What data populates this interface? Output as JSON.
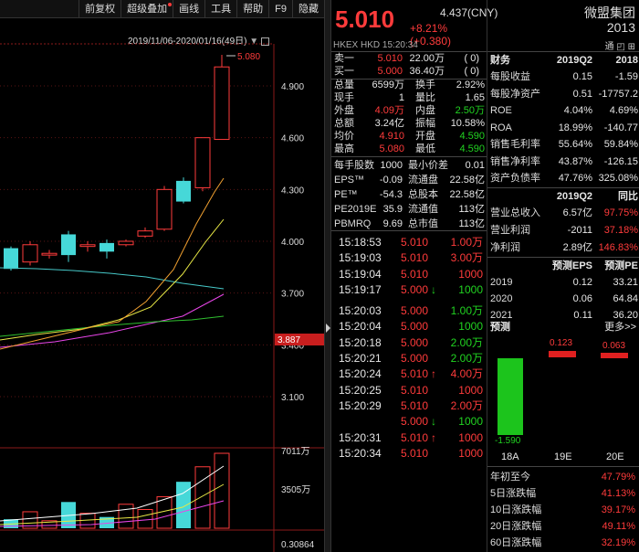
{
  "toolbar": {
    "items": [
      "前复权",
      "超级叠加",
      "画线",
      "工具",
      "帮助",
      "F9",
      "隐藏"
    ]
  },
  "chart": {
    "date_range": "2019/11/06-2020/01/16(49日)",
    "price_labels": [
      "4.900",
      "4.600",
      "4.300",
      "4.000",
      "3.700",
      "3.400",
      "3.100"
    ],
    "current_price_marker": "3.887",
    "peak_label": "5.080",
    "vol_labels": [
      "7011万",
      "3505万"
    ],
    "bottom_label": "0.30864"
  },
  "stock": {
    "price": "5.010",
    "ref": "4.437(CNY)",
    "change": "+8.21% (+0.380)",
    "name": "微盟集团",
    "code": "2013",
    "exchange": "HKEX",
    "currency": "HKD",
    "time": "15:20:34"
  },
  "orderbook": {
    "sell": {
      "label": "卖一",
      "price": "5.010",
      "vol": "22.00万",
      "cnt": "(  0)"
    },
    "buy": {
      "label": "买一",
      "price": "5.000",
      "vol": "36.40万",
      "cnt": "(  0)"
    }
  },
  "stats": [
    {
      "l1": "总量",
      "v1": "6599万",
      "c1": "white",
      "l2": "换手",
      "v2": "2.92%",
      "c2": "white"
    },
    {
      "l1": "现手",
      "v1": "1",
      "c1": "white",
      "l2": "量比",
      "v2": "1.65",
      "c2": "white"
    },
    {
      "l1": "外盘",
      "v1": "4.09万",
      "c1": "red",
      "l2": "内盘",
      "v2": "2.50万",
      "c2": "green"
    },
    {
      "l1": "总额",
      "v1": "3.24亿",
      "c1": "white",
      "l2": "振幅",
      "v2": "10.58%",
      "c2": "white"
    },
    {
      "l1": "均价",
      "v1": "4.910",
      "c1": "red",
      "l2": "开盘",
      "v2": "4.590",
      "c2": "green"
    },
    {
      "l1": "最高",
      "v1": "5.080",
      "c1": "red",
      "l2": "最低",
      "v2": "4.590",
      "c2": "green"
    }
  ],
  "stats2": [
    {
      "l1": "每手股数",
      "v1": "1000",
      "l2": "最小价差",
      "v2": "0.01"
    },
    {
      "l1": "EPS™",
      "v1": "-0.09",
      "l2": "流通盘",
      "v2": "22.58亿"
    },
    {
      "l1": "PE™",
      "v1": "-54.3",
      "l2": "总股本",
      "v2": "22.58亿"
    },
    {
      "l1": "PE2019E",
      "v1": "35.9",
      "l2": "流通值",
      "v2": "113亿"
    },
    {
      "l1": "PBMRQ",
      "v1": "9.69",
      "l2": "总市值",
      "v2": "113亿"
    }
  ],
  "ticks": [
    {
      "t": "15:18:53",
      "p": "5.010",
      "pc": "red",
      "a": "",
      "ac": "",
      "v": "1.00万",
      "vc": "red"
    },
    {
      "t": "15:19:03",
      "p": "5.010",
      "pc": "red",
      "a": "",
      "ac": "",
      "v": "3.00万",
      "vc": "red"
    },
    {
      "t": "15:19:04",
      "p": "5.010",
      "pc": "red",
      "a": "",
      "ac": "",
      "v": "1000",
      "vc": "red"
    },
    {
      "t": "15:19:17",
      "p": "5.000",
      "pc": "red",
      "a": "↓",
      "ac": "green",
      "v": "1000",
      "vc": "green"
    },
    {
      "t": "15:20:03",
      "p": "5.000",
      "pc": "red",
      "a": "",
      "ac": "",
      "v": "1.00万",
      "vc": "green"
    },
    {
      "t": "15:20:04",
      "p": "5.000",
      "pc": "red",
      "a": "",
      "ac": "",
      "v": "1000",
      "vc": "green"
    },
    {
      "t": "15:20:18",
      "p": "5.000",
      "pc": "red",
      "a": "",
      "ac": "",
      "v": "2.00万",
      "vc": "green"
    },
    {
      "t": "15:20:21",
      "p": "5.000",
      "pc": "red",
      "a": "",
      "ac": "",
      "v": "2.00万",
      "vc": "green"
    },
    {
      "t": "15:20:24",
      "p": "5.010",
      "pc": "red",
      "a": "↑",
      "ac": "red",
      "v": "4.00万",
      "vc": "red"
    },
    {
      "t": "15:20:25",
      "p": "5.010",
      "pc": "red",
      "a": "",
      "ac": "",
      "v": "1000",
      "vc": "red"
    },
    {
      "t": "15:20:29",
      "p": "5.010",
      "pc": "red",
      "a": "",
      "ac": "",
      "v": "2.00万",
      "vc": "red"
    },
    {
      "t": "",
      "p": "5.000",
      "pc": "red",
      "a": "↓",
      "ac": "green",
      "v": "1000",
      "vc": "green"
    },
    {
      "t": "15:20:31",
      "p": "5.010",
      "pc": "red",
      "a": "↑",
      "ac": "red",
      "v": "1000",
      "vc": "red"
    },
    {
      "t": "15:20:34",
      "p": "5.010",
      "pc": "red",
      "a": "",
      "ac": "",
      "v": "1000",
      "vc": "red"
    }
  ],
  "fin": {
    "header": [
      "财务",
      "2019Q2",
      "2018"
    ],
    "rows": [
      {
        "l": "每股收益",
        "a": "0.15",
        "ac": "white",
        "b": "-1.59",
        "bc": "white"
      },
      {
        "l": "每股净资产",
        "a": "0.51",
        "ac": "white",
        "b": "-17757.2",
        "bc": "white"
      },
      {
        "l": "ROE",
        "a": "4.04%",
        "ac": "white",
        "b": "4.69%",
        "bc": "white"
      },
      {
        "l": "ROA",
        "a": "18.99%",
        "ac": "white",
        "b": "-140.77",
        "bc": "white"
      },
      {
        "l": "销售毛利率",
        "a": "55.64%",
        "ac": "white",
        "b": "59.84%",
        "bc": "white"
      },
      {
        "l": "销售净利率",
        "a": "43.87%",
        "ac": "white",
        "b": "-126.15",
        "bc": "white"
      },
      {
        "l": "资产负债率",
        "a": "47.76%",
        "ac": "white",
        "b": "325.08%",
        "bc": "white"
      }
    ],
    "header2": [
      "",
      "2019Q2",
      "同比"
    ],
    "rows2": [
      {
        "l": "营业总收入",
        "a": "6.57亿",
        "ac": "white",
        "b": "97.75%",
        "bc": "red"
      },
      {
        "l": "营业利润",
        "a": "-2011",
        "ac": "white",
        "b": "37.18%",
        "bc": "red"
      },
      {
        "l": "净利润",
        "a": "2.89亿",
        "ac": "white",
        "b": "146.83%",
        "bc": "red"
      }
    ],
    "header3": [
      "",
      "预测EPS",
      "预测PE"
    ],
    "rows3": [
      {
        "l": "2019",
        "a": "0.12",
        "b": "33.21"
      },
      {
        "l": "2020",
        "a": "0.06",
        "b": "64.84"
      },
      {
        "l": "2021",
        "a": "0.11",
        "b": "36.20"
      }
    ],
    "forecast_title": "预测",
    "more": "更多>>",
    "forecast_vals": [
      "-1.590",
      "0.123",
      "0.063"
    ],
    "forecast_x": [
      "18A",
      "19E",
      "20E"
    ],
    "perf": [
      {
        "l": "年初至今",
        "v": "47.79%"
      },
      {
        "l": "5日涨跌幅",
        "v": "41.13%"
      },
      {
        "l": "10日涨跌幅",
        "v": "39.17%"
      },
      {
        "l": "20日涨跌幅",
        "v": "49.11%"
      },
      {
        "l": "60日涨跌幅",
        "v": "32.19%"
      }
    ]
  },
  "chart_data": {
    "type": "candlestick",
    "ylim": [
      3.1,
      5.08
    ],
    "candles": [
      {
        "o": 3.84,
        "c": 3.96,
        "h": 3.97,
        "l": 3.83,
        "up": false
      },
      {
        "o": 3.88,
        "c": 3.98,
        "h": 4.0,
        "l": 3.86,
        "up": true
      },
      {
        "o": 3.93,
        "c": 3.92,
        "h": 3.95,
        "l": 3.9,
        "up": true
      },
      {
        "o": 3.92,
        "c": 4.04,
        "h": 4.06,
        "l": 3.88,
        "up": false
      },
      {
        "o": 3.98,
        "c": 3.97,
        "h": 4.0,
        "l": 3.94,
        "up": true
      },
      {
        "o": 3.94,
        "c": 3.99,
        "h": 4.01,
        "l": 3.9,
        "up": false
      },
      {
        "o": 3.98,
        "c": 4.0,
        "h": 4.01,
        "l": 3.97,
        "up": true
      },
      {
        "o": 4.03,
        "c": 4.06,
        "h": 4.08,
        "l": 4.02,
        "up": true
      },
      {
        "o": 4.07,
        "c": 4.3,
        "h": 4.32,
        "l": 4.06,
        "up": true
      },
      {
        "o": 4.23,
        "c": 4.35,
        "h": 4.37,
        "l": 4.22,
        "up": false
      },
      {
        "o": 4.31,
        "c": 4.6,
        "h": 4.6,
        "l": 4.29,
        "up": true
      },
      {
        "o": 4.59,
        "c": 5.01,
        "h": 5.08,
        "l": 4.59,
        "up": true
      }
    ]
  }
}
